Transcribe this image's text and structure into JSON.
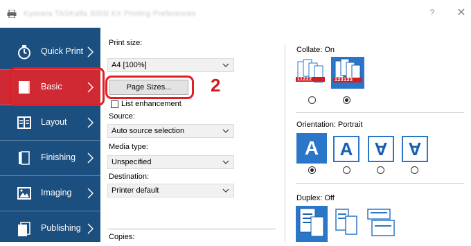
{
  "window": {
    "title": "Kyocera TASKalfa 3003i KX Printing Preferences",
    "help_label": "?",
    "close_label": "✕"
  },
  "sidebar": {
    "items": [
      {
        "label": "Quick Print",
        "icon": "stopwatch-icon"
      },
      {
        "label": "Basic",
        "icon": "page-icon"
      },
      {
        "label": "Layout",
        "icon": "layout-icon"
      },
      {
        "label": "Finishing",
        "icon": "finishing-icon"
      },
      {
        "label": "Imaging",
        "icon": "imaging-icon"
      },
      {
        "label": "Publishing",
        "icon": "publishing-icon"
      }
    ],
    "active": "Basic"
  },
  "main": {
    "print_size_label": "Print size:",
    "print_size_value": "A4  [100%]",
    "page_sizes_button": "Page Sizes...",
    "step_number": "2",
    "list_enhancement_label": "List enhancement",
    "source_label": "Source:",
    "source_value": "Auto source selection",
    "media_type_label": "Media type:",
    "media_type_value": "Unspecified",
    "destination_label": "Destination:",
    "destination_value": "Printer default",
    "copies_label": "Copies:"
  },
  "right": {
    "collate_label": "Collate:  On",
    "collate_off_text": "11222",
    "collate_on_text": "123123",
    "orientation_label": "Orientation:  Portrait",
    "orientation_glyph": "A",
    "duplex_label": "Duplex:  Off"
  },
  "colors": {
    "sidebar_bg": "#1b4f7f",
    "active_bg": "#cf2a33",
    "accent_blue": "#2a77c9",
    "annotation_red": "#e01e24"
  }
}
